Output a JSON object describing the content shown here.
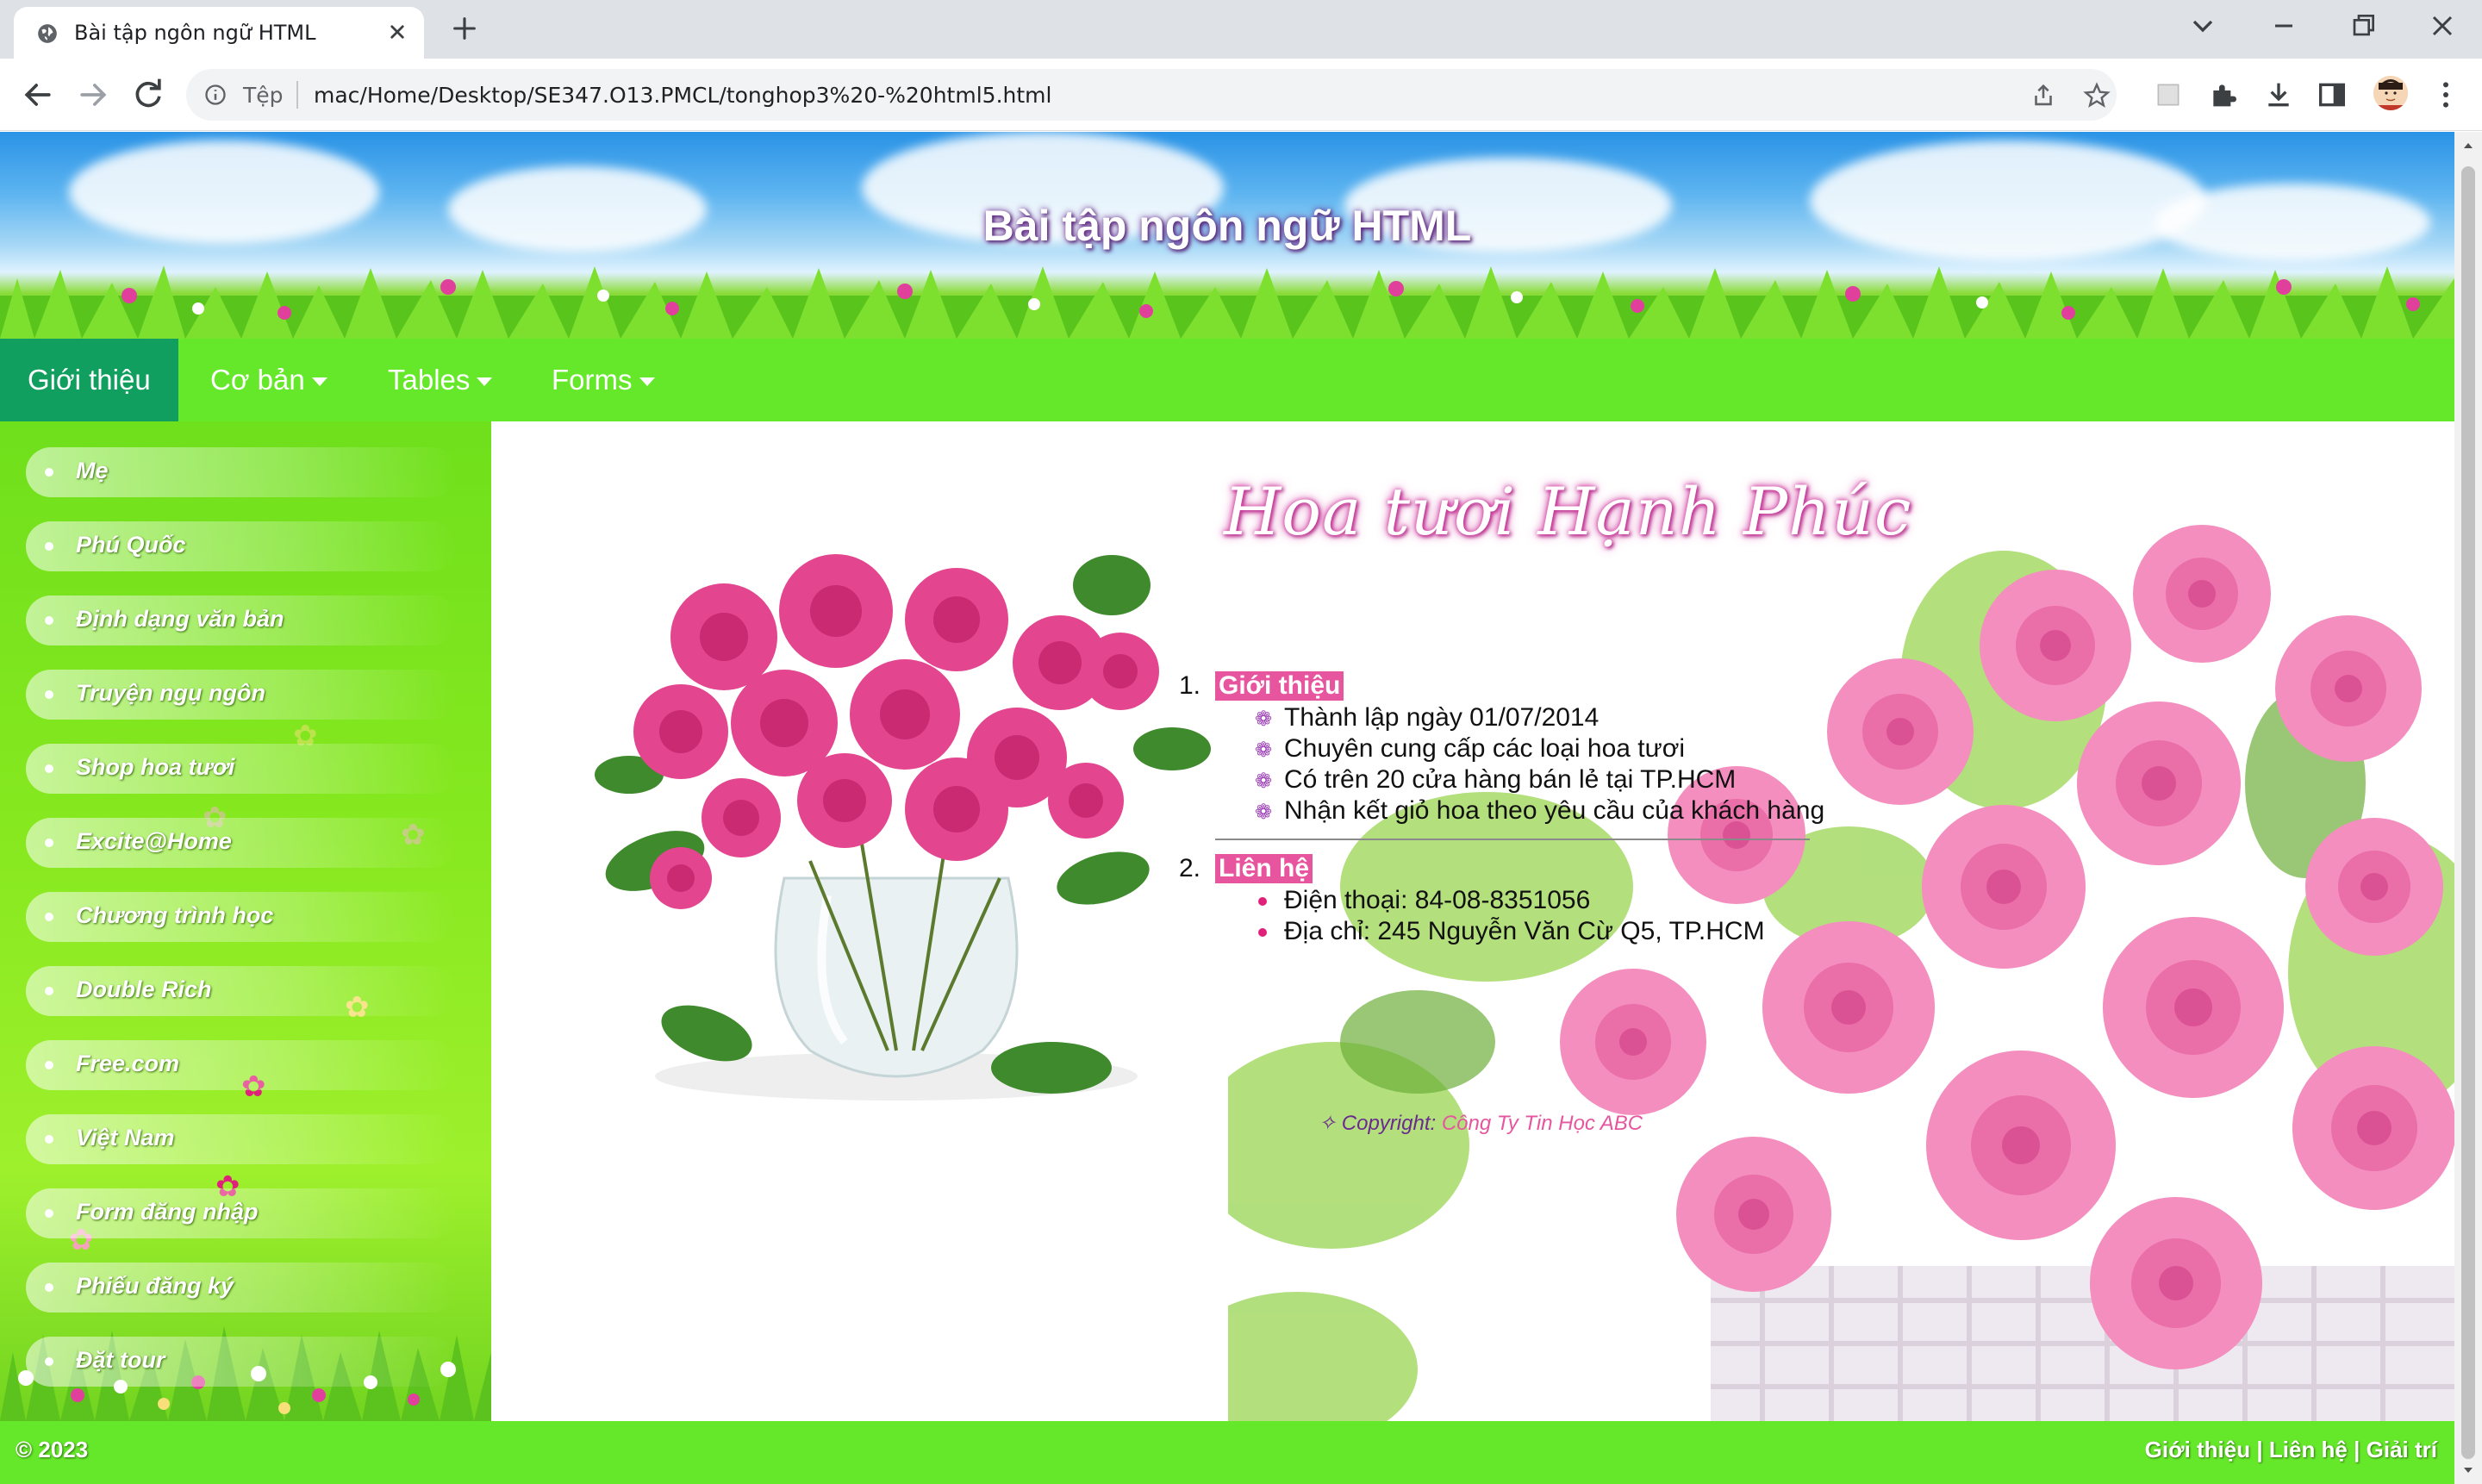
{
  "browser": {
    "tab_title": "Bài tập ngôn ngữ HTML",
    "omnibox_scheme": "Tệp",
    "omnibox_url": "mac/Home/Desktop/SE347.O13.PMCL/tonghop3%20-%20html5.html"
  },
  "page": {
    "banner_title": "Bài tập ngôn ngữ HTML",
    "nav": {
      "items": [
        {
          "label": "Giới thiệu",
          "active": true,
          "dropdown": false
        },
        {
          "label": "Cơ bản",
          "active": false,
          "dropdown": true
        },
        {
          "label": "Tables",
          "active": false,
          "dropdown": true
        },
        {
          "label": "Forms",
          "active": false,
          "dropdown": true
        }
      ]
    },
    "sidebar": {
      "items": [
        "Mẹ",
        "Phú Quốc",
        "Định dạng văn bản",
        "Truyện ngụ ngôn",
        "Shop hoa tươi",
        "Excite@Home",
        "Chương trình học",
        "Double Rich",
        "Free.com",
        "Việt Nam",
        "Form đăng nhập",
        "Phiếu đăng ký",
        "Đặt tour"
      ]
    },
    "main": {
      "script_title": "Hoa tươi Hạnh Phúc",
      "sections": [
        {
          "number": "1.",
          "heading": "Giới thiệu",
          "items": [
            "Thành lập ngày 01/07/2014",
            "Chuyên cung cấp các loại hoa tươi",
            "Có trên 20 cửa hàng bán lẻ tại TP.HCM",
            "Nhận kết giỏ hoa theo yêu cầu của khách hàng"
          ]
        },
        {
          "number": "2.",
          "heading": "Liên hệ",
          "items": [
            "Điện thoại: 84-08-8351056",
            "Địa chỉ: 245 Nguyễn Văn Cừ Q5, TP.HCM"
          ]
        }
      ],
      "copyright_label": "Copyright:",
      "copyright_company": "Công Ty Tin Học ABC"
    },
    "footer": {
      "left": "© 2023",
      "links": [
        "Giới thiệu",
        "Liên hệ",
        "Giải trí"
      ],
      "separator": "|"
    }
  },
  "colors": {
    "nav_green": "#66e82a",
    "nav_active": "#119f60",
    "heading_pink": "#e6559e",
    "bullet_purple": "#9b3fb5"
  }
}
